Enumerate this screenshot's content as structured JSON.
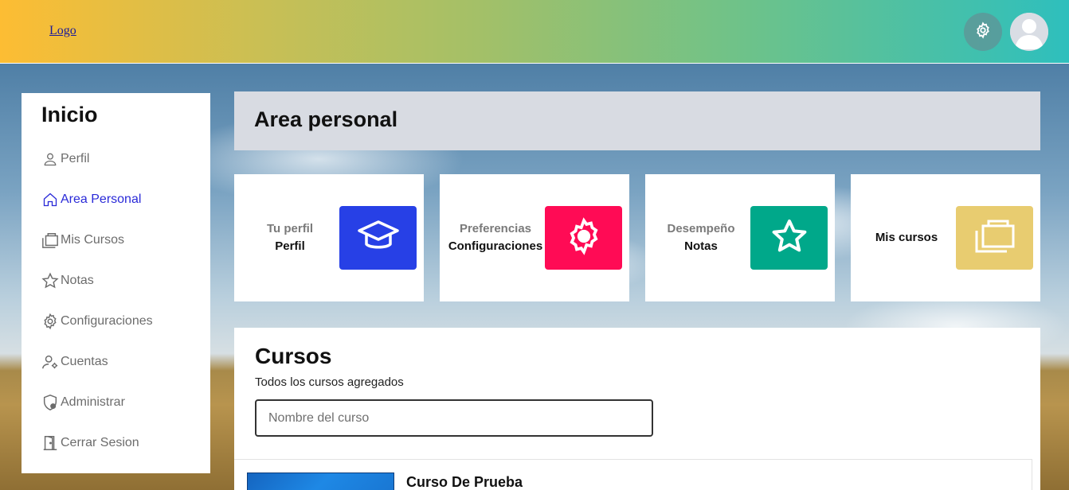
{
  "header": {
    "logo_alt": "Logo",
    "settings_icon": "gear-icon",
    "avatar_icon": "user-avatar-icon"
  },
  "sidebar": {
    "title": "Inicio",
    "items": [
      {
        "label": "Perfil",
        "icon": "user-icon",
        "active": false
      },
      {
        "label": "Area Personal",
        "icon": "home-icon",
        "active": true
      },
      {
        "label": "Mis Cursos",
        "icon": "folders-icon",
        "active": false
      },
      {
        "label": "Notas",
        "icon": "star-icon",
        "active": false
      },
      {
        "label": "Configuraciones",
        "icon": "gear-icon",
        "active": false
      },
      {
        "label": "Cuentas",
        "icon": "user-gear-icon",
        "active": false
      },
      {
        "label": "Administrar",
        "icon": "shield-icon",
        "active": false
      },
      {
        "label": "Cerrar Sesion",
        "icon": "door-icon",
        "active": false
      }
    ]
  },
  "main": {
    "title": "Area personal",
    "cards": [
      {
        "subtitle": "Tu perfil",
        "label": "Perfil",
        "icon": "graduation-cap-icon",
        "color": "#2740e6"
      },
      {
        "subtitle": "Preferencias",
        "label": "Configuraciones",
        "icon": "gear-icon",
        "color": "#ff0b55"
      },
      {
        "subtitle": "Desempeño",
        "label": "Notas",
        "icon": "star-icon",
        "color": "#00a88a"
      },
      {
        "subtitle": "",
        "label": "Mis cursos",
        "icon": "folders-icon",
        "color": "#e8cc70"
      }
    ],
    "courses": {
      "title": "Cursos",
      "subtitle": "Todos los cursos agregados",
      "search_placeholder": "Nombre del curso",
      "items": [
        {
          "name": "Curso De Prueba"
        }
      ]
    }
  },
  "colors": {
    "accent_blue": "#2a2ad8",
    "title_bar_bg": "#d8dbe2"
  }
}
